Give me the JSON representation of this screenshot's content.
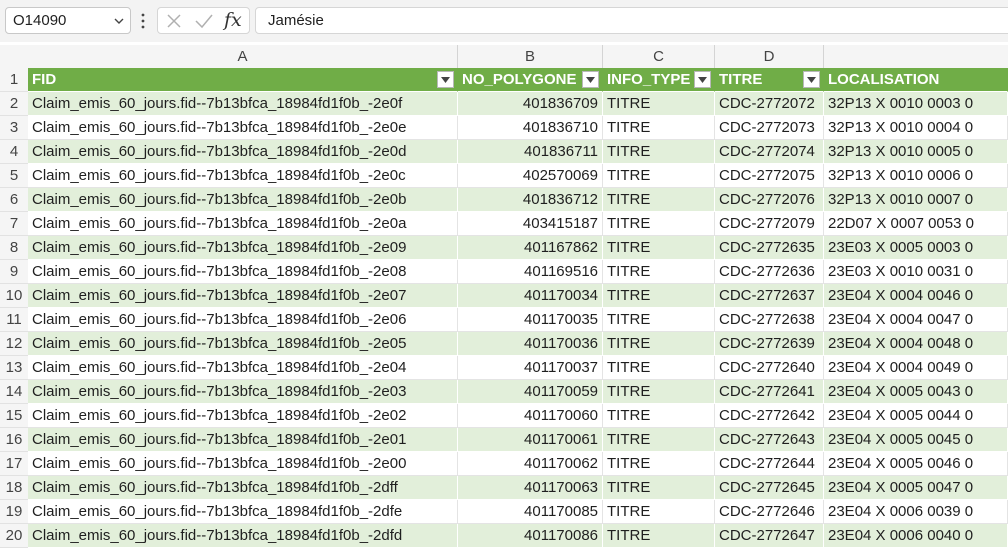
{
  "formula_bar": {
    "name_box": "O14090",
    "fx_label": "fx",
    "formula_value": "Jamésie"
  },
  "columns": [
    "A",
    "B",
    "C",
    "D"
  ],
  "table": {
    "headers": [
      "FID",
      "NO_POLYGONE",
      "INFO_TYPE",
      "TITRE",
      "LOCALISATION"
    ],
    "rows": [
      [
        "Claim_emis_60_jours.fid--7b13bfca_18984fd1f0b_-2e0f",
        "401836709",
        "TITRE",
        "CDC-2772072",
        "32P13 X 0010 0003 0"
      ],
      [
        "Claim_emis_60_jours.fid--7b13bfca_18984fd1f0b_-2e0e",
        "401836710",
        "TITRE",
        "CDC-2772073",
        "32P13 X 0010 0004 0"
      ],
      [
        "Claim_emis_60_jours.fid--7b13bfca_18984fd1f0b_-2e0d",
        "401836711",
        "TITRE",
        "CDC-2772074",
        "32P13 X 0010 0005 0"
      ],
      [
        "Claim_emis_60_jours.fid--7b13bfca_18984fd1f0b_-2e0c",
        "402570069",
        "TITRE",
        "CDC-2772075",
        "32P13 X 0010 0006 0"
      ],
      [
        "Claim_emis_60_jours.fid--7b13bfca_18984fd1f0b_-2e0b",
        "401836712",
        "TITRE",
        "CDC-2772076",
        "32P13 X 0010 0007 0"
      ],
      [
        "Claim_emis_60_jours.fid--7b13bfca_18984fd1f0b_-2e0a",
        "403415187",
        "TITRE",
        "CDC-2772079",
        "22D07 X 0007 0053 0"
      ],
      [
        "Claim_emis_60_jours.fid--7b13bfca_18984fd1f0b_-2e09",
        "401167862",
        "TITRE",
        "CDC-2772635",
        "23E03 X 0005 0003 0"
      ],
      [
        "Claim_emis_60_jours.fid--7b13bfca_18984fd1f0b_-2e08",
        "401169516",
        "TITRE",
        "CDC-2772636",
        "23E03 X 0010 0031 0"
      ],
      [
        "Claim_emis_60_jours.fid--7b13bfca_18984fd1f0b_-2e07",
        "401170034",
        "TITRE",
        "CDC-2772637",
        "23E04 X 0004 0046 0"
      ],
      [
        "Claim_emis_60_jours.fid--7b13bfca_18984fd1f0b_-2e06",
        "401170035",
        "TITRE",
        "CDC-2772638",
        "23E04 X 0004 0047 0"
      ],
      [
        "Claim_emis_60_jours.fid--7b13bfca_18984fd1f0b_-2e05",
        "401170036",
        "TITRE",
        "CDC-2772639",
        "23E04 X 0004 0048 0"
      ],
      [
        "Claim_emis_60_jours.fid--7b13bfca_18984fd1f0b_-2e04",
        "401170037",
        "TITRE",
        "CDC-2772640",
        "23E04 X 0004 0049 0"
      ],
      [
        "Claim_emis_60_jours.fid--7b13bfca_18984fd1f0b_-2e03",
        "401170059",
        "TITRE",
        "CDC-2772641",
        "23E04 X 0005 0043 0"
      ],
      [
        "Claim_emis_60_jours.fid--7b13bfca_18984fd1f0b_-2e02",
        "401170060",
        "TITRE",
        "CDC-2772642",
        "23E04 X 0005 0044 0"
      ],
      [
        "Claim_emis_60_jours.fid--7b13bfca_18984fd1f0b_-2e01",
        "401170061",
        "TITRE",
        "CDC-2772643",
        "23E04 X 0005 0045 0"
      ],
      [
        "Claim_emis_60_jours.fid--7b13bfca_18984fd1f0b_-2e00",
        "401170062",
        "TITRE",
        "CDC-2772644",
        "23E04 X 0005 0046 0"
      ],
      [
        "Claim_emis_60_jours.fid--7b13bfca_18984fd1f0b_-2dff",
        "401170063",
        "TITRE",
        "CDC-2772645",
        "23E04 X 0005 0047 0"
      ],
      [
        "Claim_emis_60_jours.fid--7b13bfca_18984fd1f0b_-2dfe",
        "401170085",
        "TITRE",
        "CDC-2772646",
        "23E04 X 0006 0039 0"
      ],
      [
        "Claim_emis_60_jours.fid--7b13bfca_18984fd1f0b_-2dfd",
        "401170086",
        "TITRE",
        "CDC-2772647",
        "23E04 X 0006 0040 0"
      ]
    ]
  },
  "colors": {
    "header_fill": "#70ad47",
    "band_green": "#e2efda",
    "band_white": "#ffffff"
  },
  "icons": {
    "name_box_dropdown": "chevron-down-icon",
    "more": "vertical-dots-icon",
    "cancel": "x-icon",
    "enter": "check-icon",
    "filter": "filter-dropdown-icon"
  }
}
